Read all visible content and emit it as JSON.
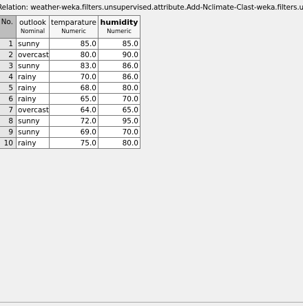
{
  "relation_label": "Relation: weather-weka.filters.unsupervised.attribute.Add-Nclimate-Clast-weka.filters.uns...",
  "columns": [
    {
      "name": "No.",
      "type": ""
    },
    {
      "name": "outlook",
      "type": "Nominal"
    },
    {
      "name": "temparature",
      "type": "Numeric"
    },
    {
      "name": "humidity",
      "type": "Numeric"
    }
  ],
  "rows": [
    {
      "no": "1",
      "outlook": "sunny",
      "temperature": "85.0",
      "humidity": "85.0"
    },
    {
      "no": "2",
      "outlook": "overcast",
      "temperature": "80.0",
      "humidity": "90.0"
    },
    {
      "no": "3",
      "outlook": "sunny",
      "temperature": "83.0",
      "humidity": "86.0"
    },
    {
      "no": "4",
      "outlook": "rainy",
      "temperature": "70.0",
      "humidity": "86.0"
    },
    {
      "no": "5",
      "outlook": "rainy",
      "temperature": "68.0",
      "humidity": "80.0"
    },
    {
      "no": "6",
      "outlook": "rainy",
      "temperature": "65.0",
      "humidity": "70.0"
    },
    {
      "no": "7",
      "outlook": "overcast",
      "temperature": "64.0",
      "humidity": "65.0"
    },
    {
      "no": "8",
      "outlook": "sunny",
      "temperature": "72.0",
      "humidity": "95.0"
    },
    {
      "no": "9",
      "outlook": "sunny",
      "temperature": "69.0",
      "humidity": "70.0"
    },
    {
      "no": "10",
      "outlook": "rainy",
      "temperature": "75.0",
      "humidity": "80.0"
    }
  ],
  "selected_column": "humidity"
}
